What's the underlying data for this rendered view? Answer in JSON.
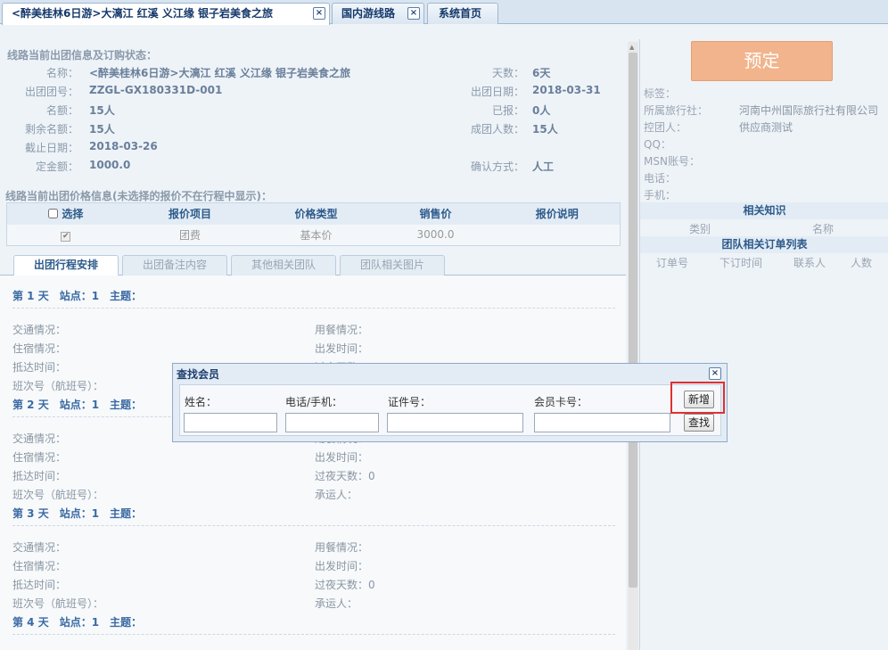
{
  "tabs": [
    {
      "label": "<醉美桂林6日游>大漓江 红溪 义江缘 银子岩美食之旅",
      "close": "×"
    },
    {
      "label": "国内游线路",
      "close": "×"
    },
    {
      "label": "系统首页"
    }
  ],
  "info": {
    "section_title": "线路当前出团信息及订购状态：",
    "name_label": "名称：",
    "name_value": "<醉美桂林6日游>大漓江 红溪 义江缘 银子岩美食之旅",
    "days_label": "天数：",
    "days_value": "6天",
    "group_no_label": "出团团号：",
    "group_no_value": "ZZGL-GX180331D-001",
    "date_label": "出团日期：",
    "date_value": "2018-03-31",
    "quota_label": "名额：",
    "quota_value": "15人",
    "reported_label": "已报：",
    "reported_value": "0人",
    "remain_label": "剩余名额：",
    "remain_value": "15人",
    "min_label": "成团人数：",
    "min_value": "15人",
    "deadline_label": "截止日期：",
    "deadline_value": "2018-03-26",
    "deposit_label": "定金额：",
    "deposit_value": "1000.0",
    "confirm_label": "确认方式：",
    "confirm_value": "人工"
  },
  "price": {
    "section_title": "线路当前出团价格信息(未选择的报价不在行程中显示)：",
    "headers": [
      "选择",
      "报价项目",
      "价格类型",
      "销售价",
      "报价说明"
    ],
    "row": {
      "check": "✔",
      "item": "团费",
      "type": "基本价",
      "price": "3000.0",
      "note": ""
    }
  },
  "subtabs": [
    "出团行程安排",
    "出团备注内容",
    "其他相关团队",
    "团队相关图片"
  ],
  "itinerary": {
    "days": [
      {
        "head": "第 1 天　站点：1　主题："
      },
      {
        "head": "第 2 天　站点：1　主题："
      },
      {
        "head": "第 3 天　站点：1　主题："
      },
      {
        "head": "第 4 天　站点：1　主题："
      }
    ],
    "traffic": "交通情况：",
    "meal": "用餐情况：",
    "hotel": "住宿情况：",
    "depart": "出发时间：",
    "arrive": "抵达时间：",
    "overnight": "过夜天数：0",
    "flight": "班次号（航班号）：",
    "carrier": "承运人："
  },
  "right": {
    "book_label": "预定",
    "tag_label": "标签：",
    "agency_label": "所属旅行社：",
    "agency_value": "河南中州国际旅行社有限公司",
    "controller_label": "控团人：",
    "controller_value": "供应商测试",
    "qq_label": "QQ：",
    "msn_label": "MSN账号：",
    "phone_label": "电话：",
    "mobile_label": "手机：",
    "knowledge_title": "相关知识",
    "knowledge_cols": [
      "类别",
      "名称"
    ],
    "orders_title": "团队相关订单列表",
    "orders_cols": [
      "订单号",
      "下订时间",
      "联系人",
      "人数"
    ]
  },
  "modal": {
    "title": "查找会员",
    "close": "×",
    "name_label": "姓名：",
    "phone_label": "电话/手机：",
    "id_label": "证件号：",
    "card_label": "会员卡号：",
    "add_button": "新增",
    "search_button": "查找"
  }
}
